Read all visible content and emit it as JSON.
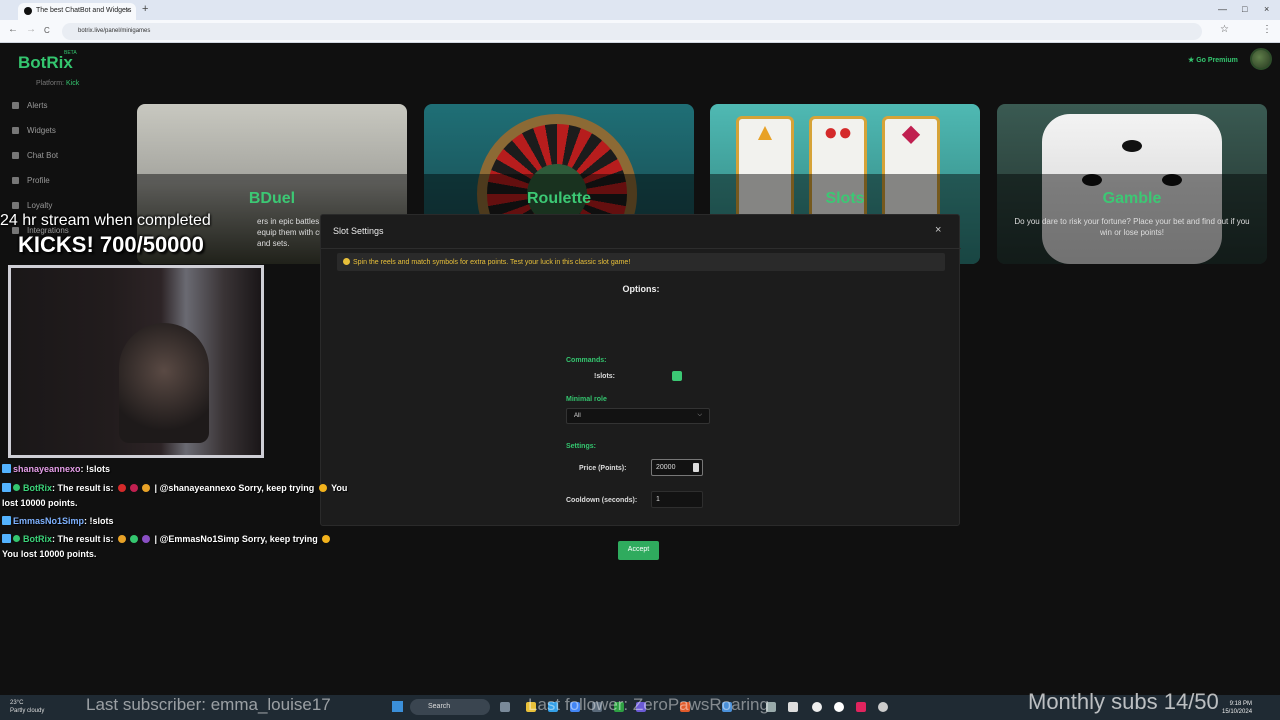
{
  "browser": {
    "tab_title": "The best ChatBot and Widgets",
    "tab_close": "×",
    "new_tab": "+",
    "url": "botrix.live/panel/minigames",
    "back": "←",
    "forward": "→",
    "reload": "C",
    "minimize": "—",
    "maximize": "□",
    "close": "×",
    "star": "☆",
    "menu": "⋮"
  },
  "app": {
    "logo": "BotRix",
    "logo_badge": "BETA",
    "platform_label": "Platform:",
    "platform_value": "Kick",
    "premium": "Go Premium",
    "nav": [
      "Alerts",
      "Widgets",
      "Chat Bot",
      "Profile",
      "Loyalty",
      "Integrations"
    ]
  },
  "games": [
    {
      "title": "BDuel",
      "desc": "ers in epic battles! character and equip them with custom weapons, and sets."
    },
    {
      "title": "Roulette",
      "desc": ""
    },
    {
      "title": "Slots",
      "desc": ""
    },
    {
      "title": "Gamble",
      "desc": "Do you dare to risk your fortune? Place your bet and find out if you win or lose points!"
    }
  ],
  "modal": {
    "title": "Slot Settings",
    "close": "×",
    "alert": "Spin the reels and match symbols for extra points. Test your luck in this classic slot game!",
    "options_heading": "Options:",
    "commands_label": "Commands:",
    "command_name": "!slots:",
    "command_enabled": true,
    "minimal_role_label": "Minimal role",
    "minimal_role_value": "All",
    "settings_label": "Settings:",
    "price_label": "Price (Points):",
    "price_value": "20000",
    "cooldown_label": "Cooldown (seconds):",
    "cooldown_value": "1",
    "accept": "Accept"
  },
  "overlay": {
    "goal_line1": "24 hr stream when completed",
    "goal_line2": "KICKS! 700/50000",
    "chat": [
      {
        "user": "shanayeannexo",
        "msg": ": !slots"
      },
      {
        "user": "BotRix",
        "msg": ": The result is:",
        "tail": "| @shanayeannexo Sorry, keep trying",
        "cont": "lost 10000 points.",
        "end": " You"
      },
      {
        "user": "EmmasNo1Simp",
        "msg": ": !slots"
      },
      {
        "user": "BotRix",
        "msg": ": The result is:",
        "tail": "| @EmmasNo1Simp Sorry, keep trying",
        "cont": "You lost 10000 points.",
        "end": ""
      }
    ],
    "last_subscriber": "Last subscriber: emma_louise17",
    "last_follower": "Last follower: ZeroPawsRoaring",
    "monthly_subs": "Monthly subs 14/50"
  },
  "taskbar": {
    "weather_temp": "23°C",
    "weather_desc": "Partly cloudy",
    "search": "Search",
    "time": "9:18 PM",
    "date": "15/10/2024"
  },
  "colors": {
    "accent": "#34c66f",
    "alert_text": "#e8c03a"
  }
}
